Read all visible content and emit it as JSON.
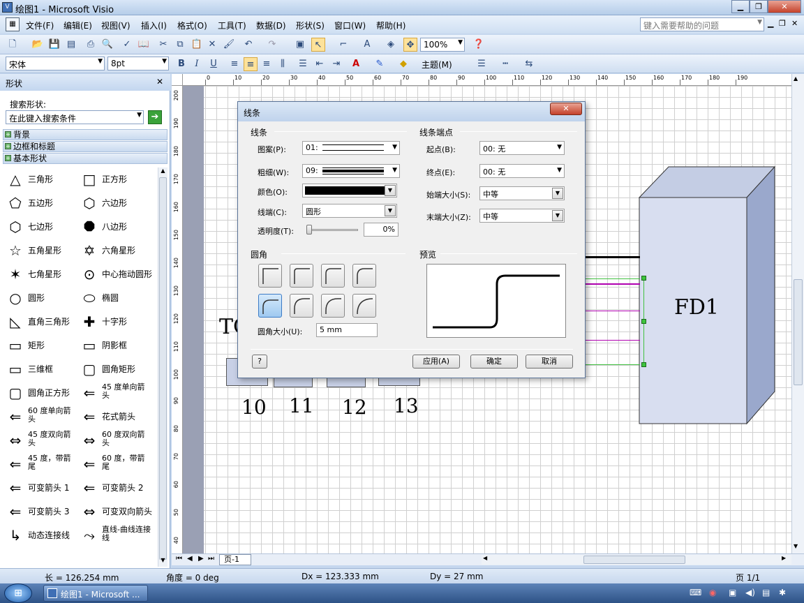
{
  "title": "绘图1 - Microsoft Visio",
  "menu": [
    "文件(F)",
    "编辑(E)",
    "视图(V)",
    "插入(I)",
    "格式(O)",
    "工具(T)",
    "数据(D)",
    "形状(S)",
    "窗口(W)",
    "帮助(H)"
  ],
  "help_placeholder": "键入需要帮助的问题",
  "zoom": "100%",
  "font": "宋体",
  "font_size": "8pt",
  "theme": "主题(M)",
  "panel": {
    "title": "形状",
    "search_label": "搜索形状:",
    "search_placeholder": "在此键入搜索条件",
    "categories": [
      "背景",
      "边框和标题",
      "基本形状"
    ],
    "shapes": [
      [
        "三角形",
        "正方形"
      ],
      [
        "五边形",
        "六边形"
      ],
      [
        "七边形",
        "八边形"
      ],
      [
        "五角星形",
        "六角星形"
      ],
      [
        "七角星形",
        "中心拖动圆形"
      ],
      [
        "圆形",
        "椭圆"
      ],
      [
        "直角三角形",
        "十字形"
      ],
      [
        "矩形",
        "阴影框"
      ],
      [
        "三维框",
        "圆角矩形"
      ],
      [
        "圆角正方形",
        "45 度单向箭头"
      ],
      [
        "60 度单向箭头",
        "花式箭头"
      ],
      [
        "45 度双向箭头",
        "60 度双向箭头"
      ],
      [
        "45 度，带箭尾",
        "60 度，带箭尾"
      ],
      [
        "可变箭头 1",
        "可变箭头 2"
      ],
      [
        "可变箭头 3",
        "可变双向箭头"
      ],
      [
        "动态连接线",
        "直线-曲线连接线"
      ]
    ]
  },
  "ruler_top": [
    "0",
    "10",
    "20",
    "30",
    "40",
    "50",
    "60",
    "70",
    "80",
    "90",
    "100",
    "110",
    "120",
    "130",
    "140",
    "150",
    "160",
    "170",
    "180",
    "190"
  ],
  "ruler_left": [
    "200",
    "190",
    "180",
    "170",
    "160",
    "150",
    "140",
    "130",
    "120",
    "110",
    "100",
    "90",
    "80",
    "70",
    "60",
    "50",
    "40"
  ],
  "canvas": {
    "box_label": "FD1",
    "partial_text": "TC",
    "numbers": [
      "10",
      "11",
      "12",
      "13"
    ]
  },
  "dialog": {
    "title": "线条",
    "group_line": "线条",
    "group_ends": "线条端点",
    "group_round": "圆角",
    "group_preview": "预览",
    "pattern_label": "图案(P):",
    "pattern_value": "01:",
    "weight_label": "粗细(W):",
    "weight_value": "09:",
    "color_label": "颜色(O):",
    "cap_label": "线端(C):",
    "cap_value": "圆形",
    "transparency_label": "透明度(T):",
    "transparency_value": "0%",
    "begin_label": "起点(B):",
    "begin_value": "00: 无",
    "end_label": "终点(E):",
    "end_value": "00: 无",
    "begin_size_label": "始端大小(S):",
    "begin_size_value": "中等",
    "end_size_label": "末端大小(Z):",
    "end_size_value": "中等",
    "round_size_label": "圆角大小(U):",
    "round_size_value": "5 mm",
    "apply": "应用(A)",
    "ok": "确定",
    "cancel": "取消"
  },
  "page_tab": "页-1",
  "status": {
    "length": "长 = 126.254 mm",
    "angle": "角度 = 0 deg",
    "dx": "Dx = 123.333 mm",
    "dy": "Dy = 27 mm",
    "page": "页 1/1"
  },
  "taskbar": {
    "item": "绘图1 - Microsoft ..."
  }
}
